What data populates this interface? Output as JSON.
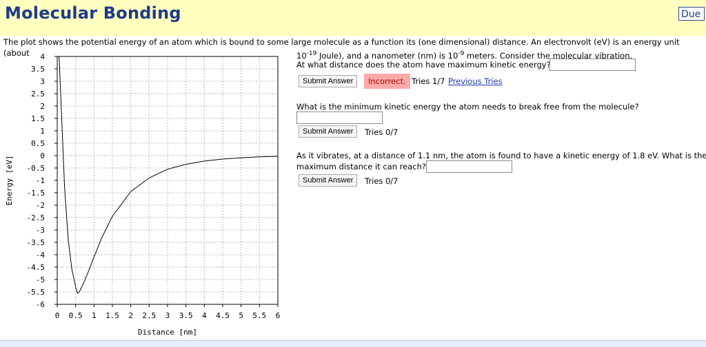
{
  "header": {
    "title": "Molecular Bonding",
    "due_label": "Due"
  },
  "intro": {
    "line1": "The plot shows the potential energy of an atom which is bound to some large molecule as a function its (one dimensional) distance. An electronvolt (eV) is an energy unit (about",
    "line2_a": "10",
    "line2_sup1": "-19",
    "line2_b": " Joule), and a nanometer (nm) is 10",
    "line2_sup2": "-9",
    "line2_c": " meters. Consider the molecular vibration."
  },
  "q1": {
    "text": "At what distance does the atom have maximum kinetic energy?",
    "value": "",
    "submit": "Submit Answer",
    "status": "Incorrect.",
    "tries": "Tries 1/7",
    "prev": "Previous Tries"
  },
  "q2": {
    "text": "What is the minimum kinetic energy the atom needs to break free from the molecule?",
    "value": "",
    "submit": "Submit Answer",
    "tries": "Tries 0/7"
  },
  "q3": {
    "text1": "As it vibrates, at a distance of 1.1 nm, the atom is found to have a kinetic energy of 1.8 eV. What is the",
    "text2": "maximum distance it can reach?",
    "value": "",
    "submit": "Submit Answer",
    "tries": "Tries 0/7"
  },
  "chart_data": {
    "type": "line",
    "xlabel": "Distance [nm]",
    "ylabel": "Energy [eV]",
    "xlim": [
      0,
      6
    ],
    "ylim": [
      -6,
      4
    ],
    "xticks": [
      "0",
      "0.5",
      "1",
      "1.5",
      "2",
      "2.5",
      "3",
      "3.5",
      "4",
      "4.5",
      "5",
      "5.5",
      "6"
    ],
    "yticks": [
      "4",
      "3.5",
      "3",
      "2.5",
      "2",
      "1.5",
      "1",
      "0.5",
      "0",
      "-0.5",
      "-1",
      "-1.5",
      "-2",
      "-2.5",
      "-3",
      "-3.5",
      "-4",
      "-4.5",
      "-5",
      "-5.5",
      "-6"
    ],
    "grid": true,
    "series": [
      {
        "x": [
          0.05,
          0.15,
          0.2,
          0.3,
          0.4,
          0.5,
          0.55,
          0.6,
          0.7,
          0.8,
          1.0,
          1.2,
          1.5,
          2.0,
          2.5,
          3.0,
          3.5,
          4.0,
          4.5,
          5.0,
          5.5,
          6.0
        ],
        "y": [
          4.0,
          0.5,
          -1.3,
          -3.4,
          -4.6,
          -5.3,
          -5.55,
          -5.5,
          -5.2,
          -4.85,
          -4.1,
          -3.35,
          -2.45,
          -1.45,
          -0.9,
          -0.55,
          -0.35,
          -0.22,
          -0.14,
          -0.09,
          -0.05,
          -0.03
        ]
      }
    ]
  }
}
